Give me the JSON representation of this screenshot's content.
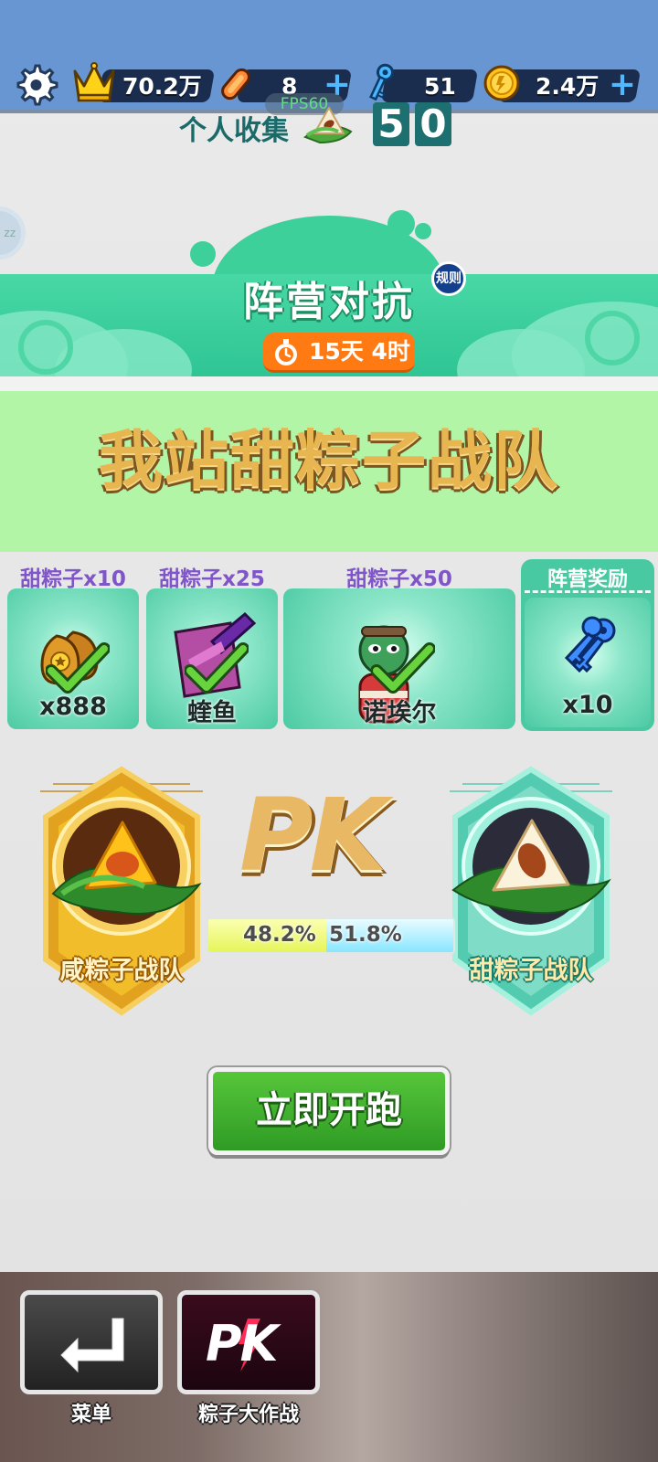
{
  "resources": {
    "crowns": "70.2万",
    "boards": "8",
    "keys": "51",
    "coins": "2.4万"
  },
  "fps": "FPS60",
  "side_bubble": "zz",
  "banner": {
    "title": "阵营对抗",
    "rules": "规则",
    "timer": "15天 4时"
  },
  "team_panel": {
    "title": "我站甜粽子战队",
    "collect_label": "个人收集",
    "collect_digits": [
      "5",
      "0"
    ]
  },
  "rewards": [
    {
      "label": "甜粽子x10",
      "count": "x888",
      "icon": "coin-bags-icon",
      "claimed": true
    },
    {
      "label": "甜粽子x25",
      "count": "蝰鱼",
      "icon": "hoverboard-icon",
      "claimed": true
    },
    {
      "label": "甜粽子x50",
      "count": "诺埃尔",
      "icon": "character-icon",
      "claimed": true
    },
    {
      "label": "阵营奖励",
      "count": "x10",
      "icon": "keys-icon",
      "claimed": false
    }
  ],
  "pk": {
    "title": "PK",
    "left_team": "咸粽子战队",
    "right_team": "甜粽子战队",
    "left_percent_text": "48.2%",
    "right_percent_text": "51.8%",
    "left_share": 48.2,
    "right_share": 51.8
  },
  "start_button": "立即开跑",
  "nav": {
    "menu_label": "菜单",
    "event_label": "粽子大作战",
    "event_icon_text": "PK"
  },
  "colors": {
    "topbar": "#6896d2",
    "banner_green": "#3dd09a",
    "team_panel": "#b2f5a6",
    "timer_orange": "#ff7a12",
    "start_green": "#3fae2e"
  }
}
